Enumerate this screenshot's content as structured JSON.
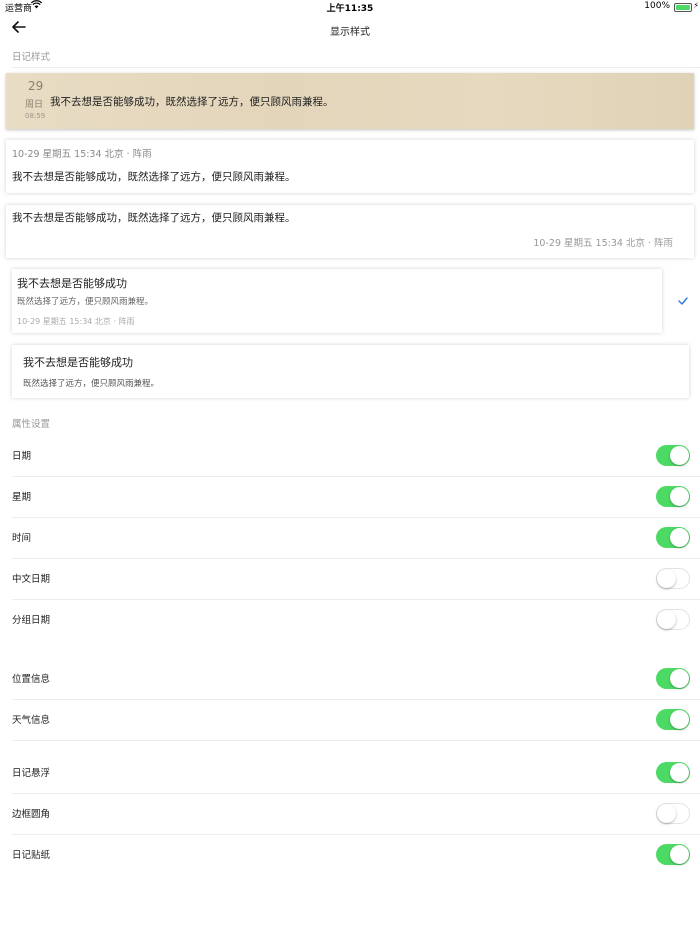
{
  "status_bar": {
    "carrier": "运营商",
    "time": "上午11:35",
    "battery": "100%",
    "battery_level": 1.0
  },
  "nav": {
    "title": "显示样式"
  },
  "sections": {
    "diary_style": "日记样式",
    "property_settings": "属性设置"
  },
  "preview": {
    "card1": {
      "day": "29",
      "weekday": "周日",
      "time": "08:59",
      "text": "我不去想是否能够成功，既然选择了远方，便只顾风雨兼程。"
    },
    "card2": {
      "meta": "10-29 星期五 15:34 北京 · 阵雨",
      "text": "我不去想是否能够成功，既然选择了远方，便只顾风雨兼程。"
    },
    "card3": {
      "text": "我不去想是否能够成功，既然选择了远方，便只顾风雨兼程。",
      "meta": "10-29 星期五 15:34 北京 · 阵雨"
    },
    "card4": {
      "title": "我不去想是否能够成功",
      "subtitle": "既然选择了远方，便只顾风雨兼程。",
      "meta": "10-29 星期五 15:34 北京 · 阵雨",
      "selected": true
    },
    "card5": {
      "title": "我不去想是否能够成功",
      "subtitle": "既然选择了远方，便只顾风雨兼程。"
    }
  },
  "settings": [
    {
      "label": "日期",
      "on": true
    },
    {
      "label": "星期",
      "on": true
    },
    {
      "label": "时间",
      "on": true
    },
    {
      "label": "中文日期",
      "on": false
    },
    {
      "label": "分组日期",
      "on": false
    },
    {
      "label": "位置信息",
      "on": true
    },
    {
      "label": "天气信息",
      "on": true
    },
    {
      "label": "日记悬浮",
      "on": true
    },
    {
      "label": "边框圆角",
      "on": false
    },
    {
      "label": "日记贴纸",
      "on": true
    }
  ],
  "colors": {
    "toggle_on": "#4cd964",
    "check": "#2a7ad9",
    "accent_card": "#e5d8bd"
  }
}
